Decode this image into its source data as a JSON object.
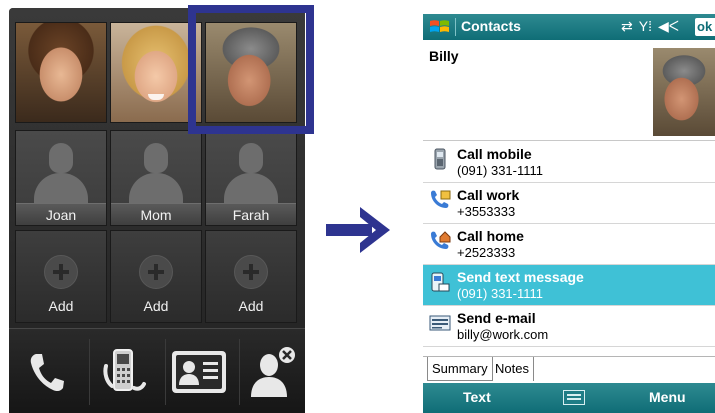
{
  "favorites": {
    "row1": [
      {
        "name": "",
        "photo": "joan-photo"
      },
      {
        "name": "",
        "photo": "mom-photo"
      },
      {
        "name": "",
        "photo": "billy-photo",
        "selected": true
      }
    ],
    "row2": [
      {
        "name": "Joan"
      },
      {
        "name": "Mom"
      },
      {
        "name": "Farah"
      }
    ],
    "row3": [
      {
        "label": "Add"
      },
      {
        "label": "Add"
      },
      {
        "label": "Add"
      }
    ],
    "bottom_buttons": [
      "phone-icon",
      "call-history-icon",
      "contact-card-icon",
      "remove-contact-icon"
    ],
    "selection_color": "#2e3490"
  },
  "arrow_color": "#2e3490",
  "contact_card": {
    "titlebar": {
      "title": "Contacts",
      "icons": [
        "sync-icon",
        "signal-icon",
        "volume-icon"
      ],
      "ok": "ok",
      "color": "#0f6d76"
    },
    "name": "Billy",
    "actions": [
      {
        "title": "Call mobile",
        "sub": "(091) 331-1111",
        "icon": "mobile-phone-icon"
      },
      {
        "title": "Call work",
        "sub": "+3553333",
        "icon": "work-phone-icon"
      },
      {
        "title": "Call home",
        "sub": "+2523333",
        "icon": "home-phone-icon"
      },
      {
        "title": "Send text message",
        "sub": "(091) 331-1111",
        "icon": "sms-icon",
        "selected": true
      },
      {
        "title": "Send e-mail",
        "sub": "billy@work.com",
        "icon": "email-icon"
      }
    ],
    "tabs": [
      "Summary",
      "Notes"
    ],
    "softkeys": {
      "left": "Text",
      "right": "Menu"
    },
    "selected_row_color": "#3fc1d6"
  }
}
